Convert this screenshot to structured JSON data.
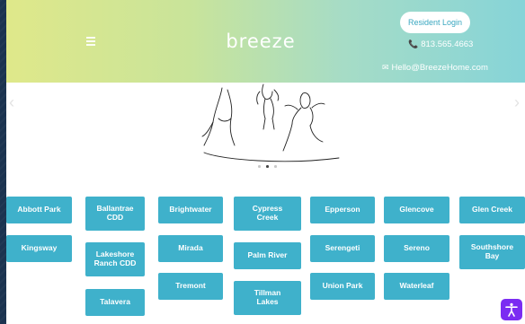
{
  "header": {
    "logo": "breeze",
    "resident_login": "Resident Login",
    "phone": "813.565.4663",
    "email": "Hello@BreezeHome.com"
  },
  "carousel": {
    "prev_arrow": "‹",
    "next_arrow": "›",
    "slide_count": 3,
    "active_slide": 2
  },
  "communities": [
    "Abbott Park",
    "Ballantrae\nCDD",
    "Brightwater",
    "Cypress\nCreek",
    "Epperson",
    "Glencove",
    "Glen Creek",
    "Kingsway",
    "Lakeshore\nRanch CDD",
    "Mirada",
    "Palm River",
    "Serengeti",
    "Sereno",
    "Southshore\nBay",
    "Talavera",
    "Tremont",
    "Tillman\nLakes",
    "Union Park",
    "Waterleaf"
  ],
  "colors": {
    "button": "#3fb1cb",
    "accessibility": "#7b2cf2"
  },
  "icons": {
    "phone": "phone-icon",
    "email": "email-icon",
    "menu": "hamburger-menu-icon",
    "accessibility": "accessibility-icon"
  }
}
